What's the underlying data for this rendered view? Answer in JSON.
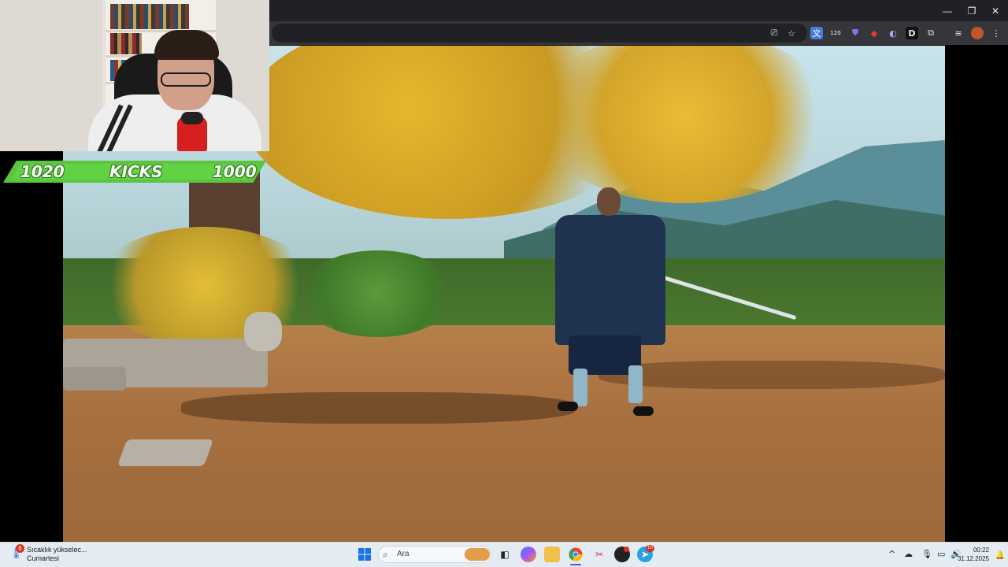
{
  "overlay": {
    "score_left": "1020",
    "label": "KICKS",
    "score_right": "1000"
  },
  "window_controls": {
    "minimize": "—",
    "restore": "❐",
    "close": "✕"
  },
  "toolbar_icons": [
    "cast-icon",
    "star-icon",
    "translate-icon",
    "counter-extension-icon",
    "shield-extension-icon",
    "fire-extension-icon",
    "planet-extension-icon",
    "d-extension-icon",
    "puzzle-icon",
    "media-icon",
    "profile-avatar",
    "menu-icon"
  ],
  "toolbar_badge": "120",
  "toolbar_d_label": "D",
  "taskbar": {
    "weather_badge": "6",
    "weather_line1": "Sıcaklık yükselec...",
    "weather_line2": "Cumartesi",
    "search_placeholder": "Ara",
    "telegram_badge": "10",
    "clock_time": "00:22",
    "clock_date": "31.12.2025"
  },
  "colors": {
    "banner_green": "#5ac53e",
    "chrome_dark": "#202124",
    "taskbar_bg": "#e4ebf2"
  }
}
